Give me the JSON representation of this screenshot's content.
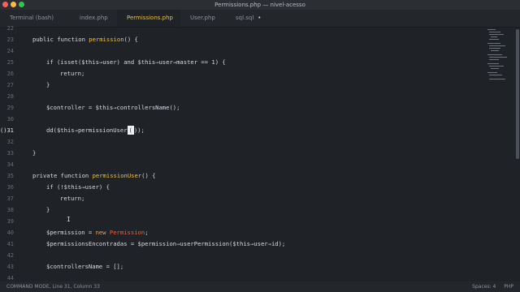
{
  "window_title": "Permissions.php — nivel-acesso",
  "tabs": [
    {
      "label": "Terminal (bash)"
    },
    {
      "label": "index.php"
    },
    {
      "label": "Permissions.php",
      "active": true
    },
    {
      "label": "User.php"
    },
    {
      "label": "sql.sql",
      "modified_marker": "•"
    }
  ],
  "line_numbers": [
    "22",
    "23",
    "24",
    "25",
    "26",
    "27",
    "28",
    "29",
    "30",
    "31",
    "32",
    "33",
    "34",
    "35",
    "36",
    "37",
    "38",
    "39",
    "40",
    "41",
    "42",
    "43",
    "44"
  ],
  "current_line_number": "31",
  "cursor_line_prefix": "()",
  "status_bar": {
    "mode_text": "COMMAND MODE, Line 31, Column 33",
    "spaces": "Spaces: 4",
    "syntax": "PHP"
  },
  "colors": {
    "editor_bg": "#1f2227",
    "keyword": "#d0d3d8",
    "function_name": "#e8c04a",
    "class_name": "#e3624a",
    "new_keyword": "#e8a25d",
    "active_tab_text": "#e8c04a"
  }
}
